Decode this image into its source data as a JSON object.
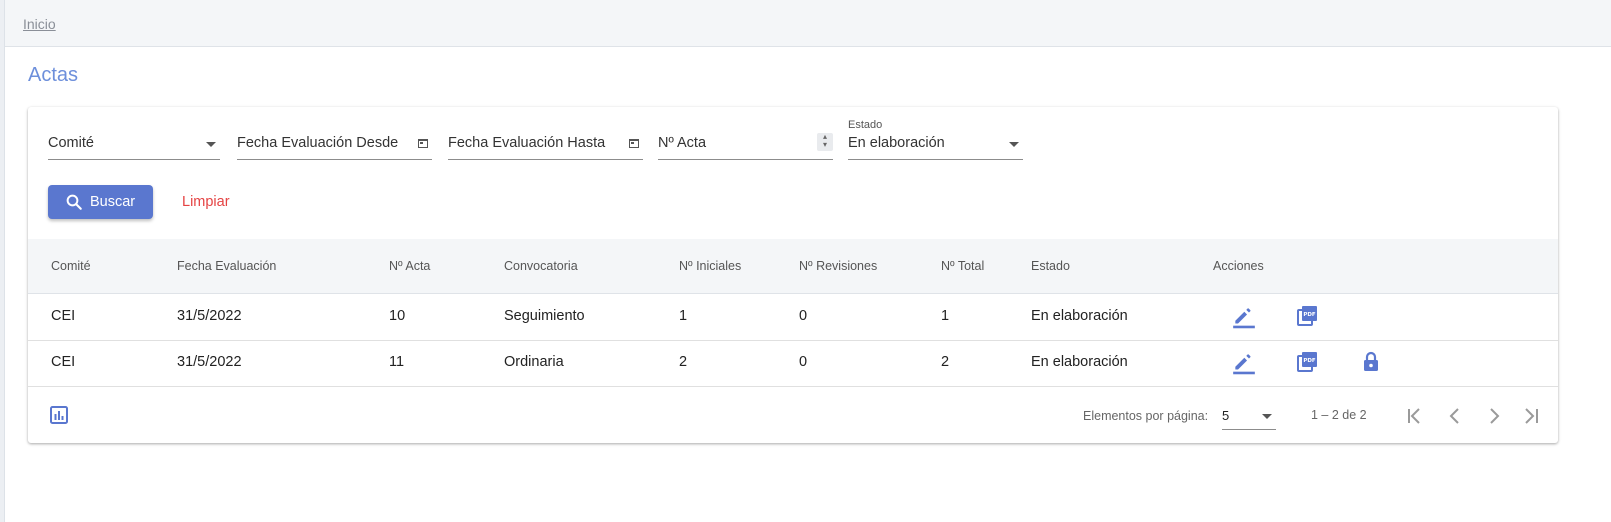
{
  "breadcrumb": {
    "home": "Inicio"
  },
  "page": {
    "title": "Actas"
  },
  "filters": {
    "comite": {
      "placeholder": "Comité",
      "value": ""
    },
    "fecha_desde": {
      "placeholder": "Fecha Evaluación Desde",
      "value": ""
    },
    "fecha_hasta": {
      "placeholder": "Fecha Evaluación Hasta",
      "value": ""
    },
    "numero_acta": {
      "placeholder": "Nº Acta",
      "value": ""
    },
    "estado": {
      "label": "Estado",
      "value": "En elaboración"
    }
  },
  "buttons": {
    "search": "Buscar",
    "clear": "Limpiar"
  },
  "table": {
    "headers": [
      "Comité",
      "Fecha Evaluación",
      "Nº Acta",
      "Convocatoria",
      "Nº Iniciales",
      "Nº Revisiones",
      "Nº Total",
      "Estado",
      "Acciones"
    ],
    "rows": [
      {
        "comite": "CEI",
        "fecha": "31/5/2022",
        "numero": "10",
        "convocatoria": "Seguimiento",
        "iniciales": "1",
        "revisiones": "0",
        "total": "1",
        "estado": "En elaboración",
        "actions": [
          "edit-icon",
          "pdf-icon"
        ]
      },
      {
        "comite": "CEI",
        "fecha": "31/5/2022",
        "numero": "11",
        "convocatoria": "Ordinaria",
        "iniciales": "2",
        "revisiones": "0",
        "total": "2",
        "estado": "En elaboración",
        "actions": [
          "edit-icon",
          "pdf-icon",
          "lock-icon"
        ]
      }
    ]
  },
  "paginator": {
    "items_per_page_label": "Elementos por página:",
    "page_size": "5",
    "range": "1 – 2 de 2"
  },
  "colors": {
    "accent": "#5a77cf",
    "title": "#6d8fdb",
    "danger": "#e54343"
  }
}
